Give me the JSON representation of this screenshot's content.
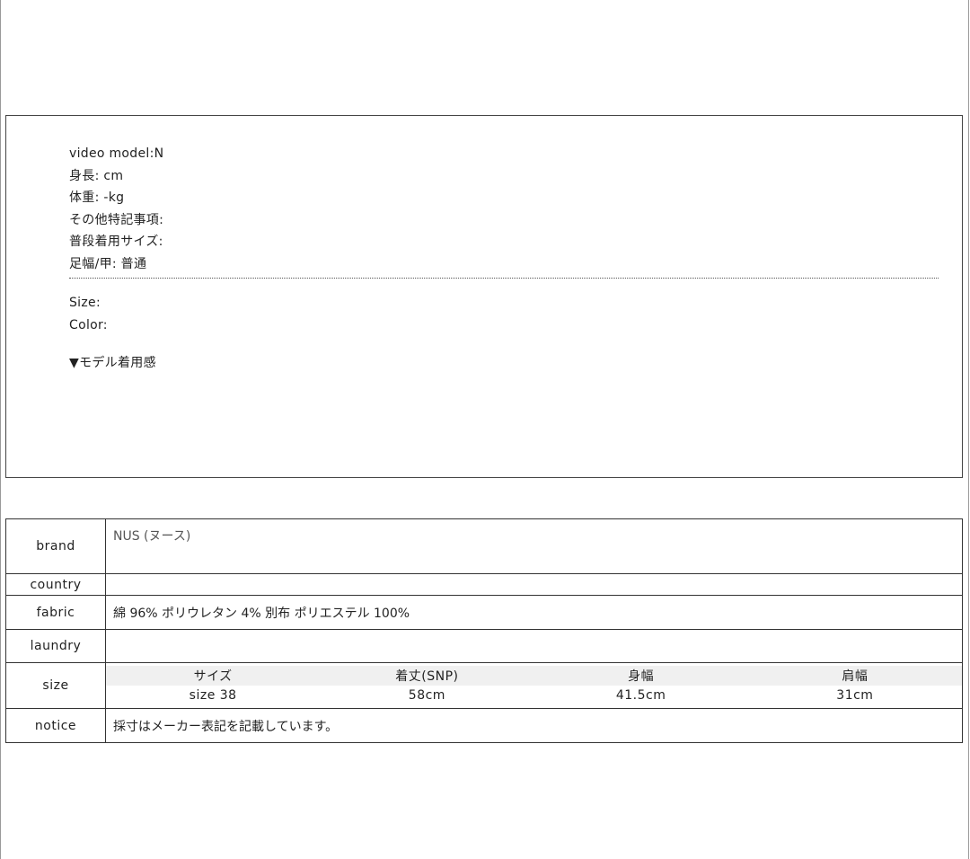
{
  "model": {
    "lines": [
      "video model:N",
      "身長: cm",
      "体重: -kg",
      "その他特記事項:",
      "普段着用サイズ:",
      "足幅/甲: 普通"
    ],
    "size_label": "Size:",
    "color_label": "Color:",
    "feel_label": "▼モデル着用感"
  },
  "spec": {
    "brand_label": "brand",
    "brand_value": "NUS (ヌース)",
    "country_label": "country",
    "country_value": "",
    "fabric_label": "fabric",
    "fabric_value": "綿 96% ポリウレタン 4% 別布 ポリエステル 100%",
    "laundry_label": "laundry",
    "laundry_value": "",
    "size_label": "size",
    "size_headers": [
      "サイズ",
      "着丈(SNP)",
      "身幅",
      "肩幅"
    ],
    "size_values": [
      "size 38",
      "58cm",
      "41.5cm",
      "31cm"
    ],
    "notice_label": "notice",
    "notice_value": "採寸はメーカー表記を記載しています。"
  }
}
